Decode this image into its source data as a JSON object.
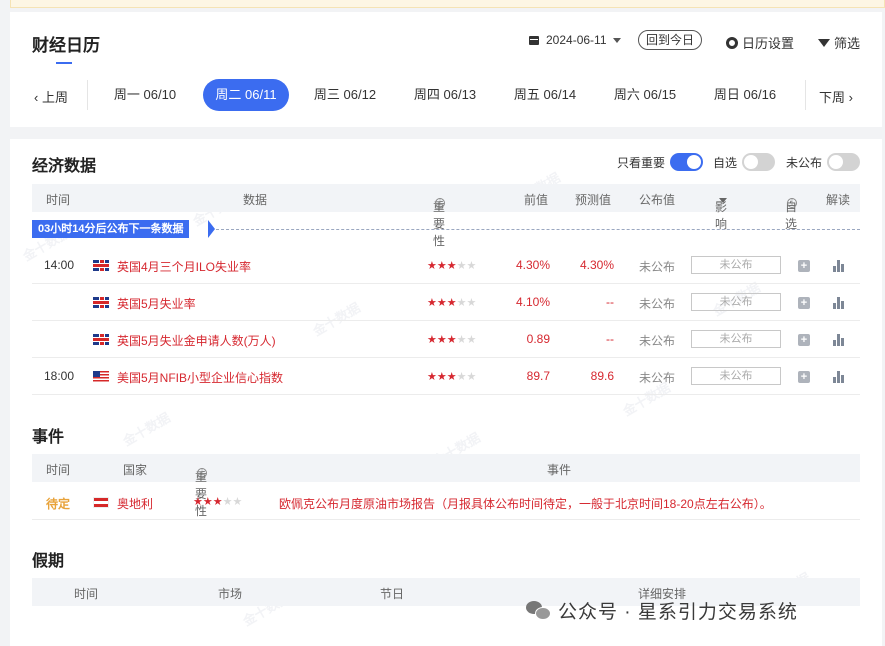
{
  "calendar": {
    "title": "财经日历",
    "date": "2024-06-11",
    "today_button": "回到今日",
    "settings_label": "日历设置",
    "filter_label": "筛选",
    "prev_week": "上周",
    "next_week": "下周",
    "days": [
      {
        "label": "周一 06/10",
        "active": false
      },
      {
        "label": "周二 06/11",
        "active": true
      },
      {
        "label": "周三 06/12",
        "active": false
      },
      {
        "label": "周四 06/13",
        "active": false
      },
      {
        "label": "周五 06/14",
        "active": false
      },
      {
        "label": "周六 06/15",
        "active": false
      },
      {
        "label": "周日 06/16",
        "active": false
      }
    ],
    "accent_color": "#3b6cf0"
  },
  "economic": {
    "title": "经济数据",
    "toggles": {
      "important_only": {
        "label": "只看重要",
        "on": true
      },
      "watchlist": {
        "label": "自选",
        "on": false
      },
      "unpublished": {
        "label": "未公布",
        "on": false
      }
    },
    "headers": {
      "time": "时间",
      "data": "数据",
      "importance": "重要性",
      "previous": "前值",
      "forecast": "预测值",
      "actual": "公布值",
      "impact": "影响",
      "watch": "自选",
      "interpret": "解读"
    },
    "notice": "03小时14分后公布下一条数据",
    "rows": [
      {
        "time": "14:00",
        "flag": "uk-flag",
        "name": "英国4月三个月ILO失业率",
        "stars": 3,
        "previous": "4.30%",
        "forecast": "4.30%",
        "actual": "未公布",
        "impact": "未公布"
      },
      {
        "time": "",
        "flag": "uk-flag",
        "name": "英国5月失业率",
        "stars": 3,
        "previous": "4.10%",
        "forecast": "--",
        "actual": "未公布",
        "impact": "未公布"
      },
      {
        "time": "",
        "flag": "uk-flag",
        "name": "英国5月失业金申请人数(万人)",
        "stars": 3,
        "previous": "0.89",
        "forecast": "--",
        "actual": "未公布",
        "impact": "未公布"
      },
      {
        "time": "18:00",
        "flag": "us-flag",
        "name": "美国5月NFIB小型企业信心指数",
        "stars": 3,
        "previous": "89.7",
        "forecast": "89.6",
        "actual": "未公布",
        "impact": "未公布"
      }
    ]
  },
  "events": {
    "title": "事件",
    "headers": {
      "time": "时间",
      "country": "国家",
      "importance": "重要性",
      "event": "事件"
    },
    "rows": [
      {
        "time": "待定",
        "flag": "austria-flag",
        "country": "奥地利",
        "stars": 3,
        "event": "欧佩克公布月度原油市场报告（月报具体公布时间待定，一般于北京时间18-20点左右公布）。"
      }
    ]
  },
  "holidays": {
    "title": "假期",
    "headers": {
      "time": "时间",
      "market": "市场",
      "holiday": "节日",
      "details": "详细安排"
    }
  },
  "footer": {
    "brand": "公众号 · 星系引力交易系统"
  }
}
